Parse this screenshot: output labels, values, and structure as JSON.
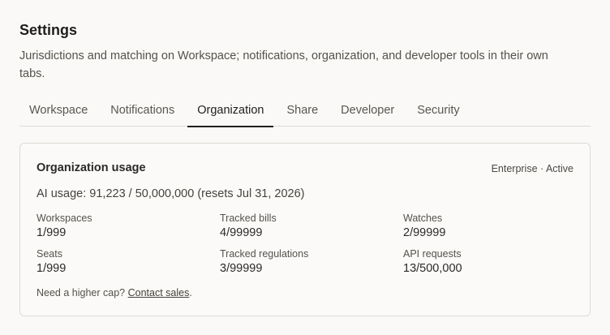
{
  "header": {
    "title": "Settings",
    "subtitle": "Jurisdictions and matching on Workspace; notifications, organization, and developer tools in their own tabs."
  },
  "tabs": [
    {
      "label": "Workspace",
      "active": false
    },
    {
      "label": "Notifications",
      "active": false
    },
    {
      "label": "Organization",
      "active": true
    },
    {
      "label": "Share",
      "active": false
    },
    {
      "label": "Developer",
      "active": false
    },
    {
      "label": "Security",
      "active": false
    }
  ],
  "card": {
    "title": "Organization usage",
    "plan_status": "Enterprise · Active",
    "ai_usage": "AI usage: 91,223 / 50,000,000 (resets Jul 31, 2026)",
    "stats": [
      {
        "label": "Workspaces",
        "value": "1/999"
      },
      {
        "label": "Tracked bills",
        "value": "4/99999"
      },
      {
        "label": "Watches",
        "value": "2/99999"
      },
      {
        "label": "Seats",
        "value": "1/999"
      },
      {
        "label": "Tracked regulations",
        "value": "3/99999"
      },
      {
        "label": "API requests",
        "value": "13/500,000"
      }
    ],
    "footer_text": "Need a higher cap? ",
    "footer_link": "Contact sales",
    "footer_end": "."
  }
}
